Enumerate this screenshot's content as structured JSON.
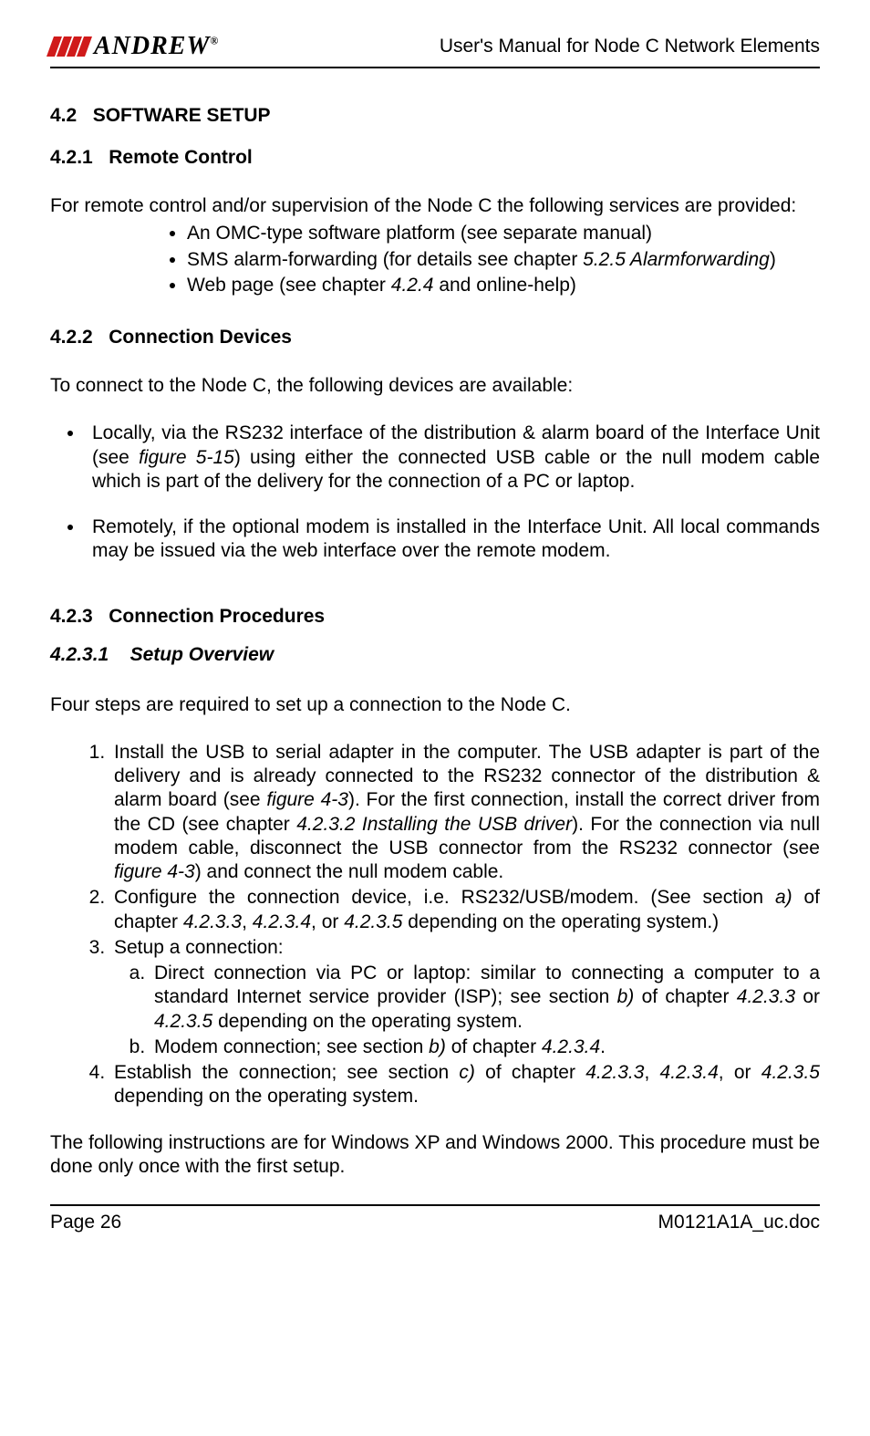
{
  "header": {
    "logo_text": "ANDREW",
    "title": "User's Manual for Node C Network Elements"
  },
  "s42": {
    "num": "4.2",
    "title": "SOFTWARE SETUP"
  },
  "s421": {
    "num": "4.2.1",
    "title": "Remote Control",
    "intro": "For remote control and/or supervision of the Node C the following services are provided:",
    "b1": "An OMC-type software platform (see separate manual)",
    "b2a": "SMS alarm-forwarding (for details see chapter ",
    "b2b": "5.2.5 Alarmforwarding",
    "b2c": ")",
    "b3a": "Web page (see chapter ",
    "b3b": "4.2.4",
    "b3c": " and online-help)"
  },
  "s422": {
    "num": "4.2.2",
    "title": "Connection Devices",
    "intro": "To connect to the Node C, the following devices are available:",
    "li1a": "Locally, via the RS232 interface of the distribution & alarm board of the Interface Unit (see ",
    "li1b": "figure 5-15",
    "li1c": ") using either the connected USB cable or the null modem cable which is part of the delivery for the connection of a PC or laptop.",
    "li2": "Remotely, if the optional modem is installed in the Interface Unit. All local commands may be issued via the web interface over the remote modem."
  },
  "s423": {
    "num": "4.2.3",
    "title": "Connection Procedures"
  },
  "s4231": {
    "num": "4.2.3.1",
    "title": "Setup Overview",
    "intro": "Four steps are required to set up a connection to the Node C.",
    "n1a": "Install the USB to serial adapter in the computer. The USB adapter is part of the delivery and is already connected to the RS232 connector of the distribution & alarm board (see ",
    "n1b": "figure 4-3",
    "n1c": "). For the first connection, install the correct driver from the CD (see chapter ",
    "n1d": "4.2.3.2 Installing the USB driver",
    "n1e": "). For the connection via null modem cable, disconnect the USB connector from the RS232 connector (see ",
    "n1f": "figure 4-3",
    "n1g": ") and connect the null modem cable.",
    "n2a": "Configure the connection device, i.e. RS232/USB/modem. (See section ",
    "n2b": "a)",
    "n2c": " of chapter ",
    "n2d": "4.2.3.3",
    "n2e": ", ",
    "n2f": "4.2.3.4",
    "n2g": ", or ",
    "n2h": "4.2.3.5",
    "n2i": " depending on the operating system.)",
    "n3": "Setup a connection:",
    "n3aa": "Direct connection via PC or laptop: similar to connecting a computer to a standard Internet service provider (ISP); see section ",
    "n3ab": "b)",
    "n3ac": " of chapter ",
    "n3ad": "4.2.3.3",
    "n3ae": " or ",
    "n3af": "4.2.3.5",
    "n3ag": " depending on the operating system.",
    "n3ba": "Modem connection; see section ",
    "n3bb": "b)",
    "n3bc": " of chapter ",
    "n3bd": "4.2.3.4",
    "n3be": ".",
    "n4a": "Establish the connection; see section ",
    "n4b": "c)",
    "n4c": " of chapter ",
    "n4d": "4.2.3.3",
    "n4e": ", ",
    "n4f": "4.2.3.4",
    "n4g": ", or ",
    "n4h": "4.2.3.5",
    "n4i": " depending on the operating system.",
    "outro": "The following instructions are for Windows XP and Windows 2000. This procedure must be done only once with the first setup."
  },
  "footer": {
    "page": "Page 26",
    "doc": "M0121A1A_uc.doc"
  }
}
